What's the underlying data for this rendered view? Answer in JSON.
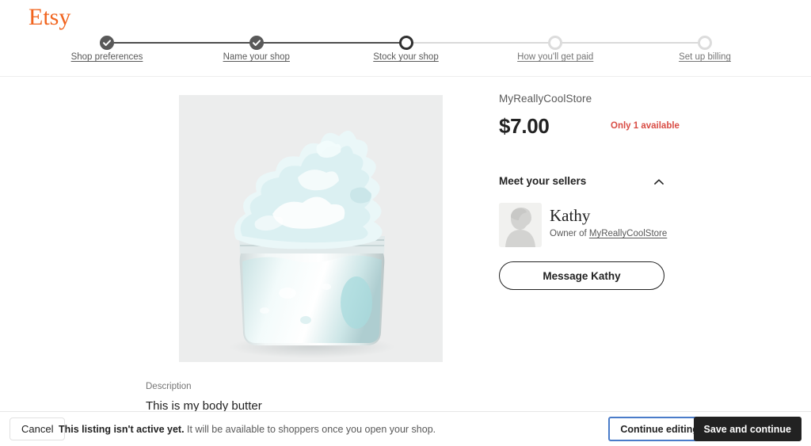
{
  "brand": {
    "logo_text": "Etsy",
    "logo_color": "#F1641E"
  },
  "stepper": {
    "steps": [
      {
        "label": "Shop preferences",
        "state": "complete"
      },
      {
        "label": "Name your shop",
        "state": "complete"
      },
      {
        "label": "Stock your shop",
        "state": "current"
      },
      {
        "label": "How you'll get paid",
        "state": "pending"
      },
      {
        "label": "Set up billing",
        "state": "pending"
      }
    ]
  },
  "listing": {
    "shop_name": "MyReallyCoolStore",
    "price": "$7.00",
    "availability": "Only 1 available",
    "description_label": "Description",
    "description_text": "This is my body butter",
    "image_alt": "whipped-body-butter-jar"
  },
  "sellers": {
    "section_title": "Meet your sellers",
    "collapse_icon": "chevron-up-icon",
    "avatar_icon": "avatar-placeholder-icon",
    "name": "Kathy",
    "role_prefix": "Owner of ",
    "shop_link": "MyReallyCoolStore",
    "message_button": "Message Kathy"
  },
  "bottom_bar": {
    "cancel_label": "Cancel",
    "status_bold": "This listing isn't active yet.",
    "status_rest": " It will be available to shoppers once you open your shop.",
    "continue_editing_label": "Continue editing",
    "save_continue_label": "Save and continue"
  },
  "colors": {
    "brand_orange": "#F1641E",
    "alert_red": "#D94C44",
    "focus_blue": "#4A7CC9",
    "dark": "#222222",
    "gray_text": "#595959"
  }
}
